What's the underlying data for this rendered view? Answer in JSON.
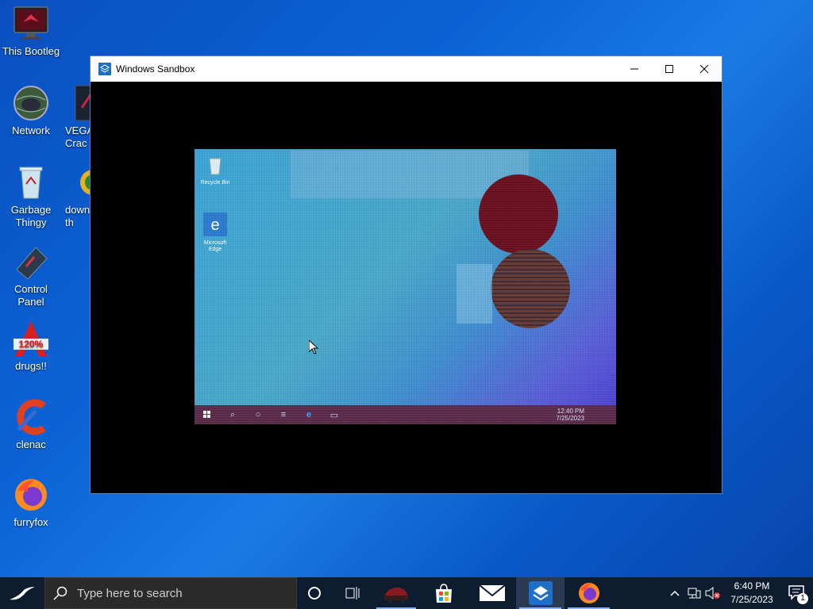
{
  "desktop": {
    "icons": [
      {
        "label": "This Bootleg",
        "icon": "computer-icon"
      },
      {
        "label": "Network",
        "icon": "network-globe-icon"
      },
      {
        "label": "VEGA\nCrac",
        "icon": "app-icon"
      },
      {
        "label": "Garbage\nThingy",
        "icon": "recycle-bin-icon"
      },
      {
        "label": "down\nth",
        "icon": "download-icon"
      },
      {
        "label": "Control\nPanel",
        "icon": "control-panel-icon"
      },
      {
        "label": "drugs!!",
        "icon": "acrobat-like-icon"
      },
      {
        "label": "clenac",
        "icon": "ccleaner-icon"
      },
      {
        "label": "furryfox",
        "icon": "firefox-icon"
      }
    ]
  },
  "window": {
    "title": "Windows Sandbox",
    "controls": [
      "minimize",
      "maximize",
      "close"
    ]
  },
  "sandbox_screen": {
    "desktop_icons": [
      {
        "label": "Recycle Bin",
        "icon": "recycle-bin-icon"
      },
      {
        "label": "Microsoft\nEdge",
        "icon": "edge-icon"
      }
    ],
    "taskbar_clock": {
      "time": "12:40 PM",
      "date": "7/25/2023"
    }
  },
  "taskbar": {
    "search_placeholder": "Type here to search",
    "apps": [
      {
        "name": "cortana-button",
        "icon": "cortana-circle-icon"
      },
      {
        "name": "task-view-button",
        "icon": "task-view-icon"
      },
      {
        "name": "game-app-button",
        "icon": "car-icon"
      },
      {
        "name": "store-button",
        "icon": "store-bag-icon"
      },
      {
        "name": "mail-button",
        "icon": "mail-icon"
      },
      {
        "name": "sandbox-button",
        "icon": "sandbox-icon",
        "active": true
      },
      {
        "name": "firefox-button",
        "icon": "firefox-icon"
      }
    ],
    "clock": {
      "time": "6:40 PM",
      "date": "7/25/2023"
    },
    "notifications_count": "1"
  },
  "colors": {
    "taskbar_bg": "#0e1c30",
    "desktop_blue": "#0b63d6",
    "accent": "#7fb4ff"
  }
}
